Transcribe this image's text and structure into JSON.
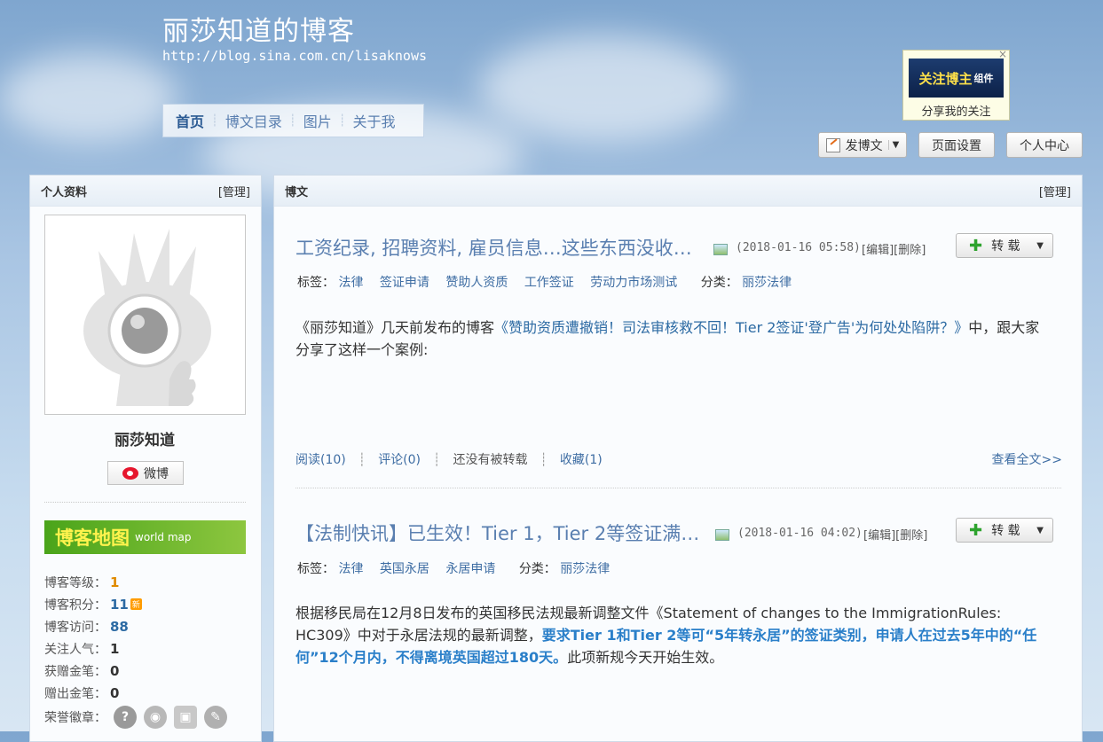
{
  "header": {
    "title": "丽莎知道的博客",
    "url": "http://blog.sina.com.cn/lisaknows"
  },
  "nav": {
    "items": [
      "首页",
      "博文目录",
      "图片",
      "关于我"
    ],
    "active": "首页"
  },
  "follow_widget": {
    "banner_main": "关注博主",
    "banner_sub": "组件",
    "share": "分享我的关注",
    "close": "×"
  },
  "toolbar": {
    "post_label": "发博文",
    "settings_label": "页面设置",
    "center_label": "个人中心"
  },
  "sidebar": {
    "title": "个人资料",
    "manage": "[管理]",
    "name": "丽莎知道",
    "weibo_label": "微博",
    "map_main": "博客地图",
    "map_sub": "world map",
    "stats": [
      {
        "label": "博客等级：",
        "value": "1"
      },
      {
        "label": "博客积分：",
        "value": "11"
      },
      {
        "label": "博客访问：",
        "value": "88"
      },
      {
        "label": "关注人气：",
        "value": "1"
      },
      {
        "label": "获赠金笔：",
        "value": "0"
      },
      {
        "label": "赠出金笔：",
        "value": "0"
      },
      {
        "label": "荣誉徽章：",
        "value": ""
      }
    ],
    "new_badge": "新"
  },
  "main": {
    "title": "博文",
    "manage": "[管理]",
    "repost_label": "转 载",
    "edit_label": "[编辑]",
    "delete_label": "[删除]",
    "tags_label": "标签：",
    "category_label": "分类：",
    "read_more": "查看全文>>",
    "posts": [
      {
        "title": "工资纪录, 招聘资料, 雇员信息…这些东西没收…",
        "time": "(2018-01-16 05:58)",
        "tags": [
          "法律",
          "签证申请",
          "赞助人资质",
          "工作签证",
          "劳动力市场测试"
        ],
        "category": "丽莎法律",
        "body_pre": "《丽莎知道》几天前发布的博客",
        "body_link": "《赞助资质遭撤销！司法审核救不回！Tier 2签证'登广告'为何处处陷阱？》",
        "body_post": "中，跟大家分享了这样一个案例:",
        "read": "阅读(10)",
        "comment": "评论(0)",
        "reposted": "还没有被转载",
        "fav": "收藏(1)"
      },
      {
        "title": "【法制快讯】已生效！Tier 1，Tier 2等签证满…",
        "time": "(2018-01-16 04:02)",
        "tags": [
          "法律",
          "英国永居",
          "永居申请"
        ],
        "category": "丽莎法律",
        "body_pre": "根据移民局在12月8日发布的英国移民法规最新调整文件《Statement of changes to the ImmigrationRules: HC309》中对于永居法规的最新调整，",
        "body_highlight": "要求Tier 1和Tier 2等可“5年转永居”的签证类别，申请人在过去5年中的“任何”12个月内，不得离境英国超过180天。",
        "body_post": "此项新规今天开始生效。"
      }
    ]
  }
}
